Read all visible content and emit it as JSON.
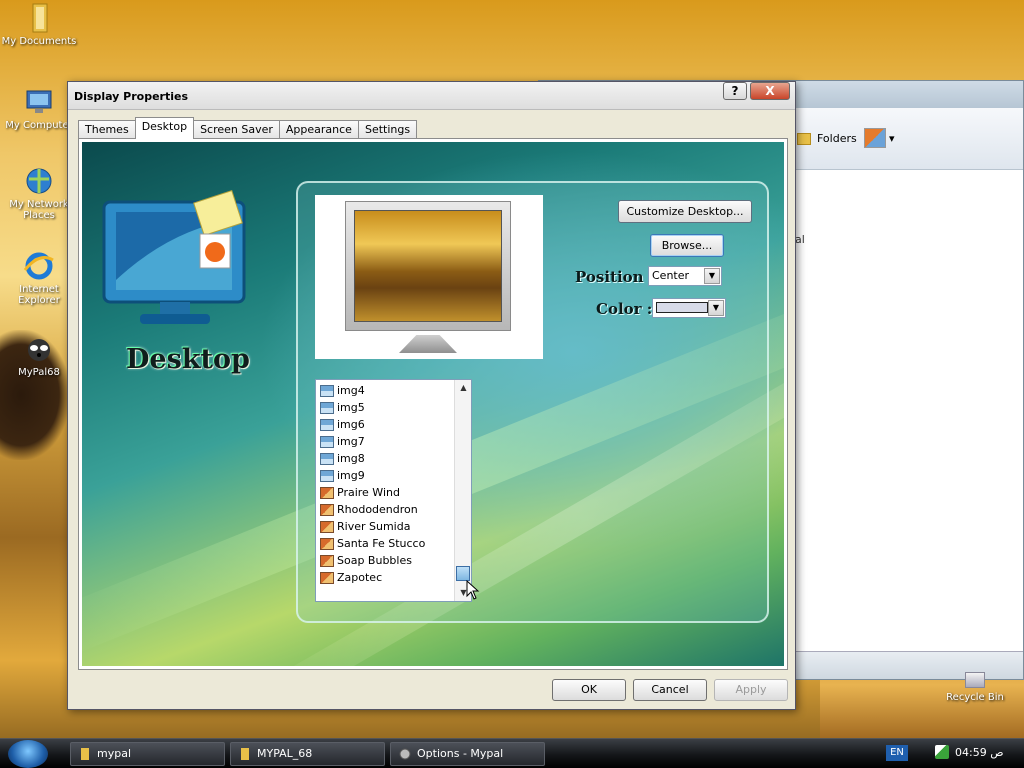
{
  "desktop": {
    "icons": [
      {
        "label": "My Documents",
        "icon": "folder-icon"
      },
      {
        "label": "My Computer",
        "icon": "computer-icon"
      },
      {
        "label": "My Network Places",
        "icon": "network-icon"
      },
      {
        "label": "Internet Explorer",
        "icon": "ie-icon"
      },
      {
        "label": "MyPal68",
        "icon": "mypal-icon"
      }
    ],
    "recycle_bin": "Recycle Bin"
  },
  "explorer": {
    "folders_label": "Folders",
    "fragment": "al"
  },
  "dialog": {
    "title": "Display Properties",
    "help": "?",
    "close": "X",
    "tabs": [
      "Themes",
      "Desktop",
      "Screen Saver",
      "Appearance",
      "Settings"
    ],
    "active_tab": "Desktop",
    "heading": "Desktop",
    "customize_button": "Customize Desktop...",
    "browse_button": "Browse...",
    "position_label": "Position :",
    "position_value": "Center",
    "color_label": "Color :",
    "color_value": "#d8dbe9",
    "backgrounds": [
      "img4",
      "img5",
      "img6",
      "img7",
      "img8",
      "img9",
      "Praire Wind",
      "Rhododendron",
      "River Sumida",
      "Santa Fe Stucco",
      "Soap Bubbles",
      "Zapotec"
    ],
    "scroll_position": 1.0,
    "ok": "OK",
    "cancel": "Cancel",
    "apply": "Apply"
  },
  "taskbar": {
    "buttons": [
      "mypal",
      "MYPAL_68",
      "Options - Mypal"
    ],
    "language": "EN",
    "clock": "04:59 ص"
  }
}
